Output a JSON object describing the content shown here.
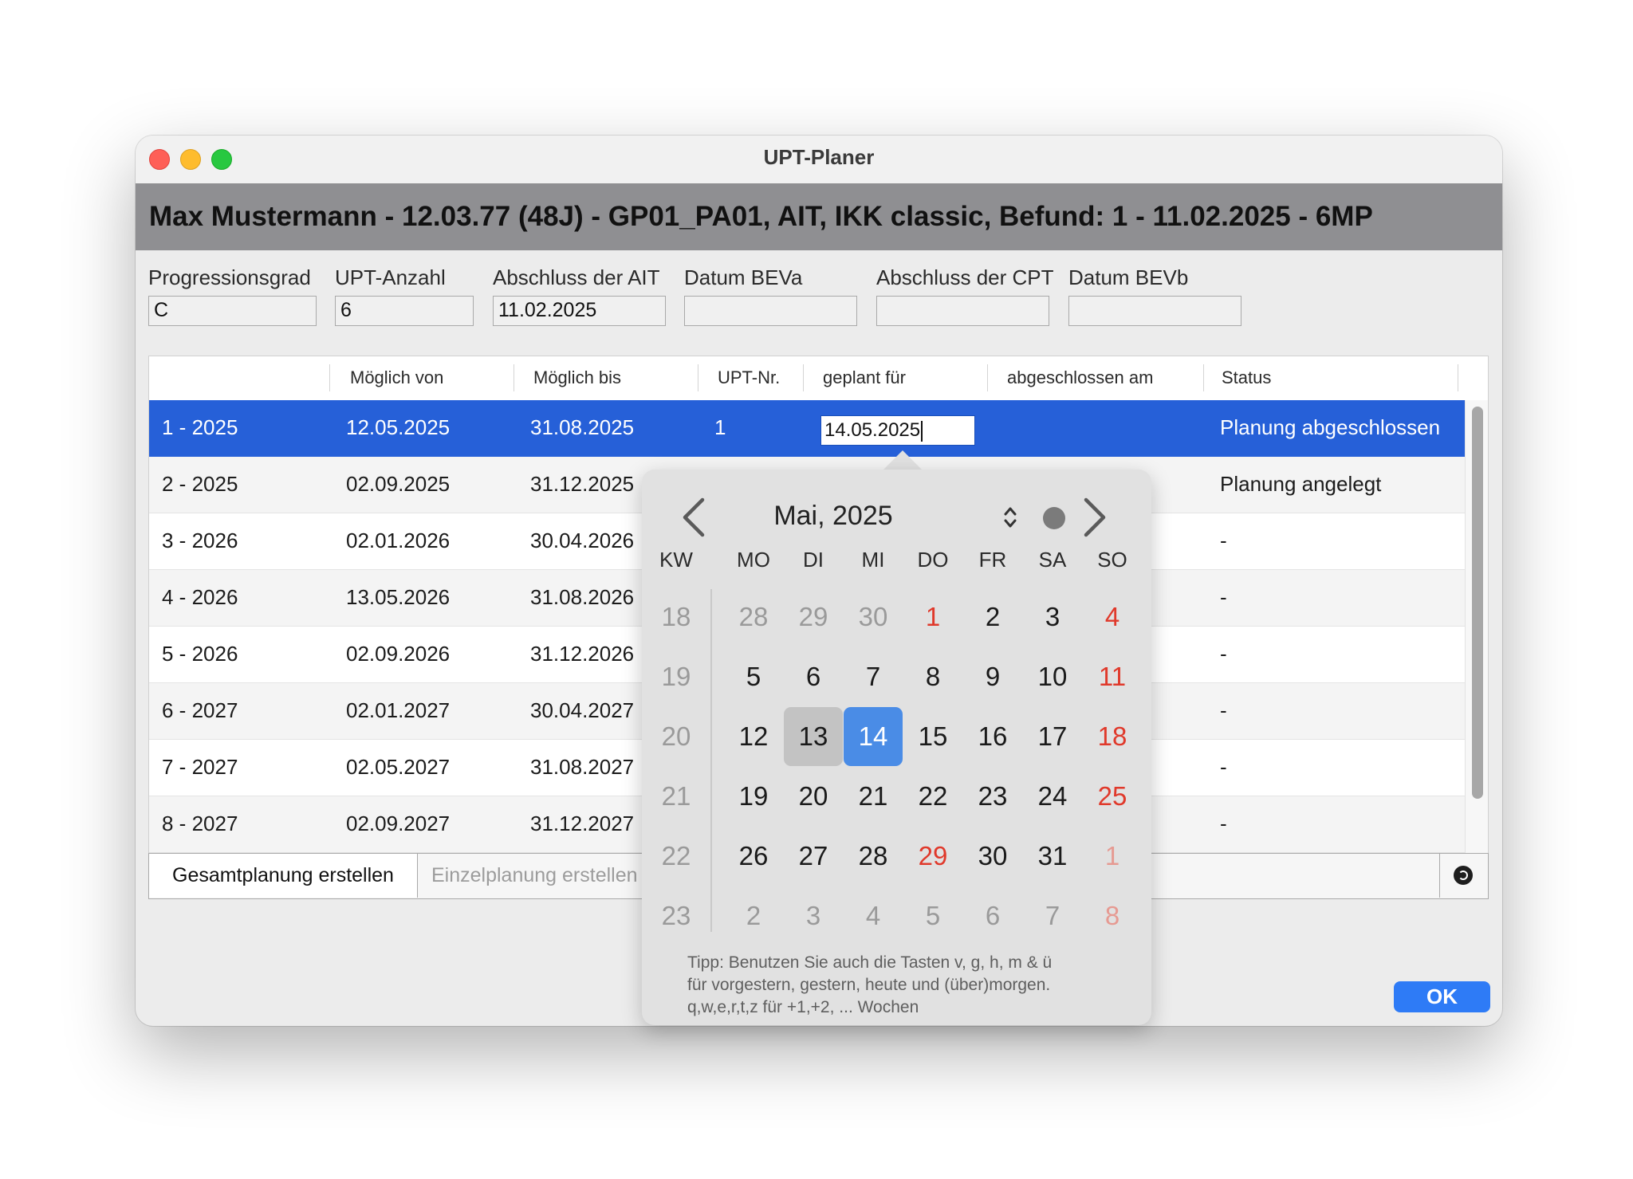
{
  "window": {
    "title": "UPT-Planer"
  },
  "patient": {
    "header": "Max Mustermann - 12.03.77 (48J) - GP01_PA01, AIT, IKK classic, Befund: 1 - 11.02.2025 - 6MP"
  },
  "fields": [
    {
      "label": "Progressionsgrad",
      "value": "C"
    },
    {
      "label": "UPT-Anzahl",
      "value": "6"
    },
    {
      "label": "Abschluss der AIT",
      "value": "11.02.2025"
    },
    {
      "label": "Datum BEVa",
      "value": ""
    },
    {
      "label": "Abschluss der CPT",
      "value": ""
    },
    {
      "label": "Datum BEVb",
      "value": ""
    }
  ],
  "table": {
    "columns": [
      "",
      "Möglich von",
      "Möglich bis",
      "UPT-Nr.",
      "geplant für",
      "abgeschlossen am",
      "Status"
    ],
    "rows": [
      {
        "id": "1 - 2025",
        "from": "12.05.2025",
        "to": "31.08.2025",
        "nr": "1",
        "planned": "14.05.2025",
        "done": "",
        "status": "Planung abgeschlossen"
      },
      {
        "id": "2 - 2025",
        "from": "02.09.2025",
        "to": "31.12.2025",
        "nr": "",
        "planned": "",
        "done": "",
        "status": "Planung angelegt"
      },
      {
        "id": "3 - 2026",
        "from": "02.01.2026",
        "to": "30.04.2026",
        "nr": "",
        "planned": "",
        "done": "",
        "status": "-"
      },
      {
        "id": "4 - 2026",
        "from": "13.05.2026",
        "to": "31.08.2026",
        "nr": "",
        "planned": "",
        "done": "",
        "status": "-"
      },
      {
        "id": "5 - 2026",
        "from": "02.09.2026",
        "to": "31.12.2026",
        "nr": "",
        "planned": "",
        "done": "",
        "status": "-"
      },
      {
        "id": "6 - 2027",
        "from": "02.01.2027",
        "to": "30.04.2027",
        "nr": "",
        "planned": "",
        "done": "",
        "status": "-"
      },
      {
        "id": "7 - 2027",
        "from": "02.05.2027",
        "to": "31.08.2027",
        "nr": "",
        "planned": "",
        "done": "",
        "status": "-"
      },
      {
        "id": "8 - 2027",
        "from": "02.09.2027",
        "to": "31.12.2027",
        "nr": "",
        "planned": "",
        "done": "",
        "status": "-"
      }
    ]
  },
  "buttons": {
    "gesamt": "Gesamtplanung erstellen",
    "einzel": "Einzelplanung erstellen",
    "ok": "OK",
    "refresh_icon": "refresh-icon"
  },
  "datepicker": {
    "month_label": "Mai, 2025",
    "headers": [
      "KW",
      "MO",
      "DI",
      "MI",
      "DO",
      "FR",
      "SA",
      "SO"
    ],
    "weeks": [
      {
        "kw": "18",
        "days": [
          {
            "d": "28",
            "t": "other"
          },
          {
            "d": "29",
            "t": "other"
          },
          {
            "d": "30",
            "t": "other"
          },
          {
            "d": "1",
            "t": "holiday"
          },
          {
            "d": "2",
            "t": ""
          },
          {
            "d": "3",
            "t": ""
          },
          {
            "d": "4",
            "t": "holiday"
          }
        ]
      },
      {
        "kw": "19",
        "days": [
          {
            "d": "5",
            "t": ""
          },
          {
            "d": "6",
            "t": ""
          },
          {
            "d": "7",
            "t": ""
          },
          {
            "d": "8",
            "t": ""
          },
          {
            "d": "9",
            "t": ""
          },
          {
            "d": "10",
            "t": ""
          },
          {
            "d": "11",
            "t": "holiday"
          }
        ]
      },
      {
        "kw": "20",
        "days": [
          {
            "d": "12",
            "t": ""
          },
          {
            "d": "13",
            "t": "hover"
          },
          {
            "d": "14",
            "t": "sel"
          },
          {
            "d": "15",
            "t": ""
          },
          {
            "d": "16",
            "t": ""
          },
          {
            "d": "17",
            "t": ""
          },
          {
            "d": "18",
            "t": "holiday"
          }
        ]
      },
      {
        "kw": "21",
        "days": [
          {
            "d": "19",
            "t": ""
          },
          {
            "d": "20",
            "t": ""
          },
          {
            "d": "21",
            "t": ""
          },
          {
            "d": "22",
            "t": ""
          },
          {
            "d": "23",
            "t": ""
          },
          {
            "d": "24",
            "t": ""
          },
          {
            "d": "25",
            "t": "holiday"
          }
        ]
      },
      {
        "kw": "22",
        "days": [
          {
            "d": "26",
            "t": ""
          },
          {
            "d": "27",
            "t": ""
          },
          {
            "d": "28",
            "t": ""
          },
          {
            "d": "29",
            "t": "holiday"
          },
          {
            "d": "30",
            "t": ""
          },
          {
            "d": "31",
            "t": ""
          },
          {
            "d": "1",
            "t": "other-holiday"
          }
        ]
      },
      {
        "kw": "23",
        "days": [
          {
            "d": "2",
            "t": "other"
          },
          {
            "d": "3",
            "t": "other"
          },
          {
            "d": "4",
            "t": "other"
          },
          {
            "d": "5",
            "t": "other"
          },
          {
            "d": "6",
            "t": "other"
          },
          {
            "d": "7",
            "t": "other"
          },
          {
            "d": "8",
            "t": "other-holiday"
          }
        ]
      }
    ],
    "tip_lines": [
      "Tipp: Benutzen Sie auch die Tasten v, g, h, m & ü",
      "für vorgestern, gestern, heute und (über)morgen.",
      "q,w,e,r,t,z für +1,+2, ... Wochen"
    ],
    "colors": {
      "selected": "#4a8ce6",
      "holiday": "#e0392b",
      "hover": "#c3c3c3"
    }
  },
  "colors": {
    "selection": "#2660d8",
    "ok_button": "#2e7bf6",
    "banner": "#8f8f92"
  }
}
